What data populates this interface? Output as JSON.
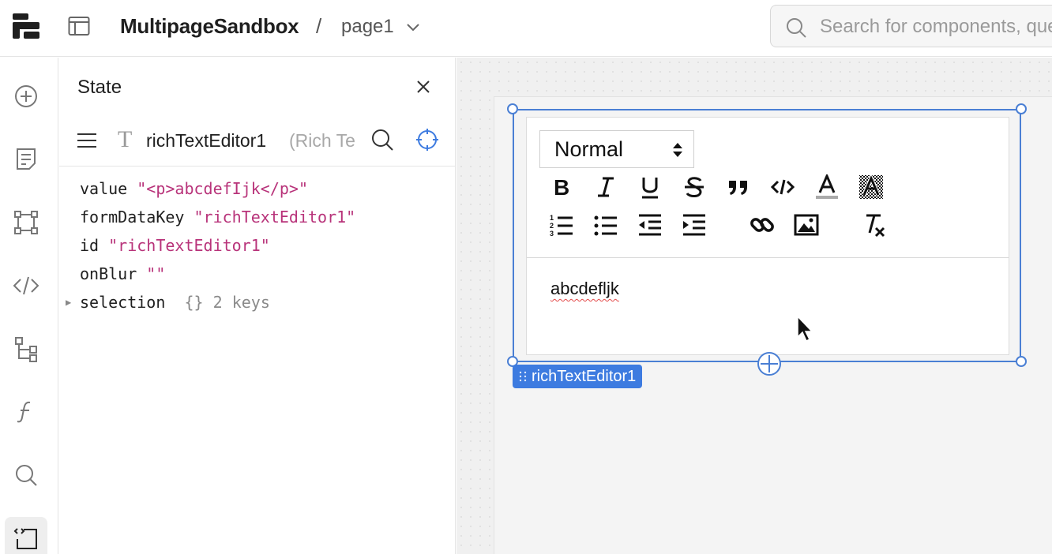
{
  "header": {
    "app_title": "MultipageSandbox",
    "separator": "/",
    "page_name": "page1",
    "search_placeholder": "Search for components, queries"
  },
  "sidebar": {
    "items": [
      {
        "name": "add-icon"
      },
      {
        "name": "notes-icon"
      },
      {
        "name": "component-icon"
      },
      {
        "name": "code-icon"
      },
      {
        "name": "tree-icon"
      },
      {
        "name": "function-icon"
      },
      {
        "name": "search-icon"
      },
      {
        "name": "state-icon",
        "active": true
      }
    ]
  },
  "state_panel": {
    "title": "State",
    "component_name": "richTextEditor1",
    "component_type": "(Rich Text Editor)",
    "rows": [
      {
        "key": "value",
        "value": "\"<p>abcdefIjk</p>\""
      },
      {
        "key": "formDataKey",
        "value": "\"richTextEditor1\""
      },
      {
        "key": "id",
        "value": "\"richTextEditor1\""
      },
      {
        "key": "onBlur",
        "value": "\"\""
      },
      {
        "key": "selection",
        "braces": "{}",
        "meta": "2 keys"
      }
    ]
  },
  "editor": {
    "format_value": "Normal",
    "content": "abcdefljk",
    "selection_label": "richTextEditor1"
  },
  "colors": {
    "accent": "#4a7fd4",
    "label_bg": "#3d7be0",
    "string_value": "#b8337a"
  }
}
